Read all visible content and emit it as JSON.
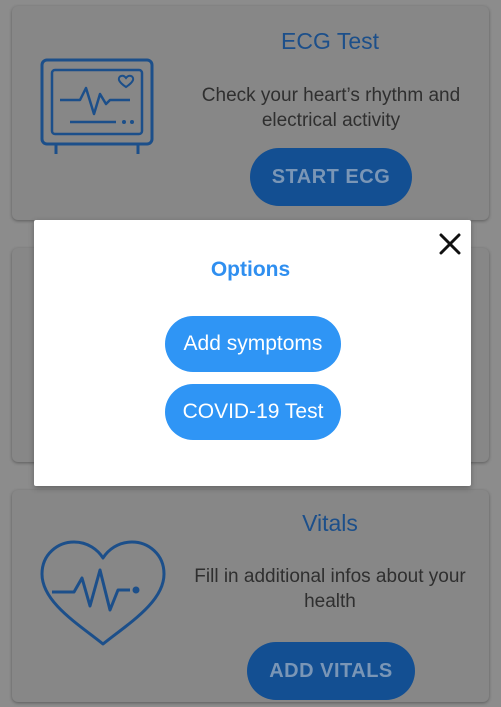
{
  "cards": {
    "ecg": {
      "title": "ECG Test",
      "description": "Check your heart’s rhythm and electrical activity",
      "button_label": "START ECG",
      "icon": "ecg-monitor-icon"
    },
    "vitals": {
      "title": "Vitals",
      "description": "Fill in additional infos about your health",
      "button_label": "ADD VITALS",
      "icon": "heart-pulse-icon"
    }
  },
  "modal": {
    "title": "Options",
    "options": [
      {
        "label": "Add symptoms"
      },
      {
        "label": "COVID-19 Test"
      }
    ],
    "close_icon": "close-icon"
  },
  "colors": {
    "accent": "#2f95f5",
    "title_blue": "#2f8ff0",
    "dimmed_button": "#134f92",
    "dimmed_icon": "#1c4f8a",
    "overlay_bg": "#8c8c8c"
  }
}
